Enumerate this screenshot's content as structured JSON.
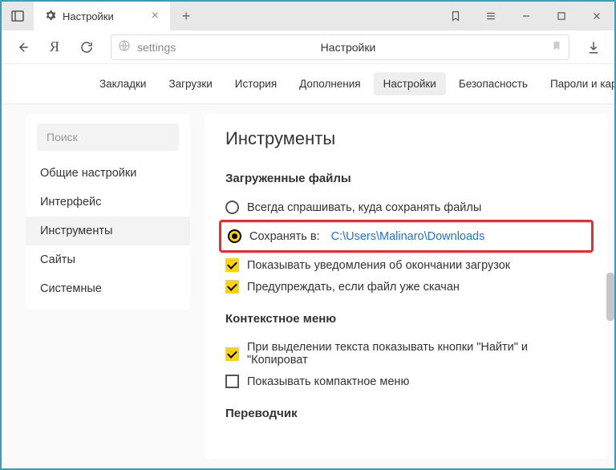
{
  "titlebar": {
    "tab_title": "Настройки"
  },
  "addressbar": {
    "url": "settings",
    "page_title": "Настройки"
  },
  "tabnav": {
    "items": [
      "Закладки",
      "Загрузки",
      "История",
      "Дополнения",
      "Настройки",
      "Безопасность",
      "Пароли и карты"
    ],
    "active_index": 4
  },
  "sidebar": {
    "search_placeholder": "Поиск",
    "items": [
      "Общие настройки",
      "Интерфейс",
      "Инструменты",
      "Сайты",
      "Системные"
    ],
    "active_index": 2
  },
  "main": {
    "heading": "Инструменты",
    "sections": {
      "downloads": {
        "title": "Загруженные файлы",
        "ask_always": "Всегда спрашивать, куда сохранять файлы",
        "save_to_label": "Сохранять в:",
        "save_to_path": "C:\\Users\\Malinaro\\Downloads",
        "show_notifications": "Показывать уведомления об окончании загрузок",
        "warn_duplicate": "Предупреждать, если файл уже скачан"
      },
      "context_menu": {
        "title": "Контекстное меню",
        "selection_buttons": "При выделении текста показывать кнопки \"Найти\" и \"Копироват",
        "compact_menu": "Показывать компактное меню"
      },
      "translator": {
        "title": "Переводчик"
      }
    }
  }
}
